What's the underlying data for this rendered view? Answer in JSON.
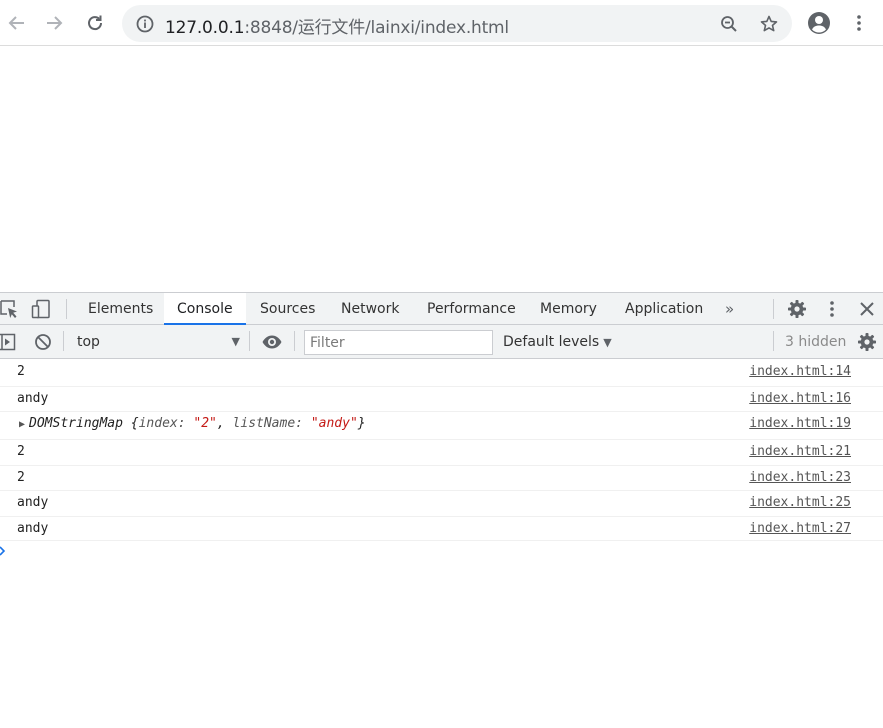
{
  "browser": {
    "url_host": "127.0.0.1",
    "url_rest": ":8848/运行文件/lainxi/index.html",
    "icons": {
      "back": "arrow-left-icon",
      "forward": "arrow-right-icon",
      "reload": "reload-icon",
      "site_info": "info-icon",
      "zoom": "zoom-out-icon",
      "bookmark": "star-icon",
      "profile": "account-circle-icon",
      "menu": "kebab-menu-icon"
    }
  },
  "devtools": {
    "tabs": [
      "Elements",
      "Console",
      "Sources",
      "Network",
      "Performance",
      "Memory",
      "Application"
    ],
    "active_tab": "Console",
    "overflow_label": "»",
    "console_toolbar": {
      "context": "top",
      "filter_placeholder": "Filter",
      "levels_label": "Default levels",
      "hidden_label": "3 hidden"
    },
    "accent_color": "#1a73e8"
  },
  "console": {
    "messages": [
      {
        "text": "2",
        "source": "index.html:14"
      },
      {
        "text": "andy",
        "source": "index.html:16"
      },
      {
        "object": {
          "name": "DOMStringMap",
          "open": "{",
          "k1": "index: ",
          "v1": "\"2\"",
          "sep": ", ",
          "k2": "listName: ",
          "v2": "\"andy\"",
          "close": "}"
        },
        "source": "index.html:19"
      },
      {
        "text": "2",
        "source": "index.html:21"
      },
      {
        "text": "2",
        "source": "index.html:23"
      },
      {
        "text": "andy",
        "source": "index.html:25"
      },
      {
        "text": "andy",
        "source": "index.html:27"
      }
    ]
  }
}
